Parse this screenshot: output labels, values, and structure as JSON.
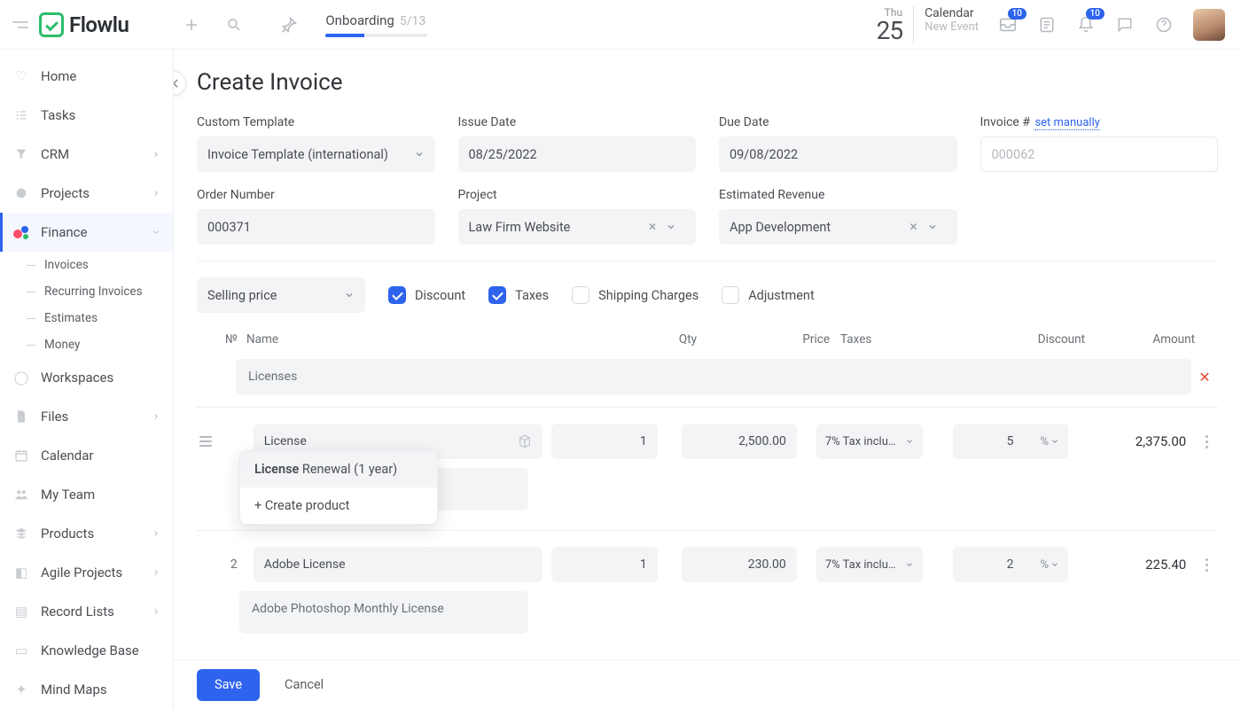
{
  "brand": {
    "name": "Flowlu"
  },
  "onboarding": {
    "label": "Onboarding",
    "progress_text": "5/13",
    "progress_pct": 38
  },
  "topbar": {
    "date_dow": "Thu",
    "date_day": "25",
    "calendar_label": "Calendar",
    "new_event_label": "New Event",
    "inbox_badge": "10",
    "bell_badge": "10"
  },
  "sidebar": {
    "items": [
      {
        "label": "Home"
      },
      {
        "label": "Tasks"
      },
      {
        "label": "CRM",
        "expandable": true
      },
      {
        "label": "Projects",
        "expandable": true
      },
      {
        "label": "Finance",
        "expandable": true,
        "active": true,
        "children": [
          {
            "label": "Invoices"
          },
          {
            "label": "Recurring Invoices"
          },
          {
            "label": "Estimates"
          },
          {
            "label": "Money"
          }
        ]
      },
      {
        "label": "Workspaces"
      },
      {
        "label": "Files",
        "expandable": true
      },
      {
        "label": "Calendar"
      },
      {
        "label": "My Team"
      },
      {
        "label": "Products",
        "expandable": true
      },
      {
        "label": "Agile Projects",
        "expandable": true
      },
      {
        "label": "Record Lists",
        "expandable": true
      },
      {
        "label": "Knowledge Base"
      },
      {
        "label": "Mind Maps"
      }
    ]
  },
  "page": {
    "title": "Create Invoice"
  },
  "form": {
    "template_label": "Custom Template",
    "template_value": "Invoice Template (international)",
    "issue_label": "Issue Date",
    "issue_value": "08/25/2022",
    "due_label": "Due Date",
    "due_value": "09/08/2022",
    "invoice_label": "Invoice #",
    "invoice_link": "set manually",
    "invoice_placeholder": "000062",
    "order_label": "Order Number",
    "order_value": "000371",
    "project_label": "Project",
    "project_value": "Law Firm Website",
    "revenue_label": "Estimated Revenue",
    "revenue_value": "App Development"
  },
  "options": {
    "price_select": "Selling price",
    "discount": "Discount",
    "taxes": "Taxes",
    "shipping": "Shipping Charges",
    "adjustment": "Adjustment"
  },
  "table": {
    "col_no": "№",
    "col_name": "Name",
    "col_qty": "Qty",
    "col_price": "Price",
    "col_taxes": "Taxes",
    "col_discount": "Discount",
    "col_amount": "Amount",
    "section1": "Licenses",
    "item1": {
      "no": "",
      "name": "License",
      "qty": "1",
      "price": "2,500.00",
      "tax": "7% Tax inclu…",
      "disc": "5",
      "disc_unit": "%",
      "amount": "2,375.00",
      "desc": ""
    },
    "item2": {
      "no": "2",
      "name": "Adobe License",
      "qty": "1",
      "price": "230.00",
      "tax": "7% Tax inclu…",
      "disc": "2",
      "disc_unit": "%",
      "amount": "225.40",
      "desc": "Adobe Photoshop Monthly License"
    }
  },
  "dropdown": {
    "match_prefix": "License",
    "match_rest": " Renewal (1 year)",
    "create": "+ Create product"
  },
  "footer": {
    "save": "Save",
    "cancel": "Cancel"
  }
}
